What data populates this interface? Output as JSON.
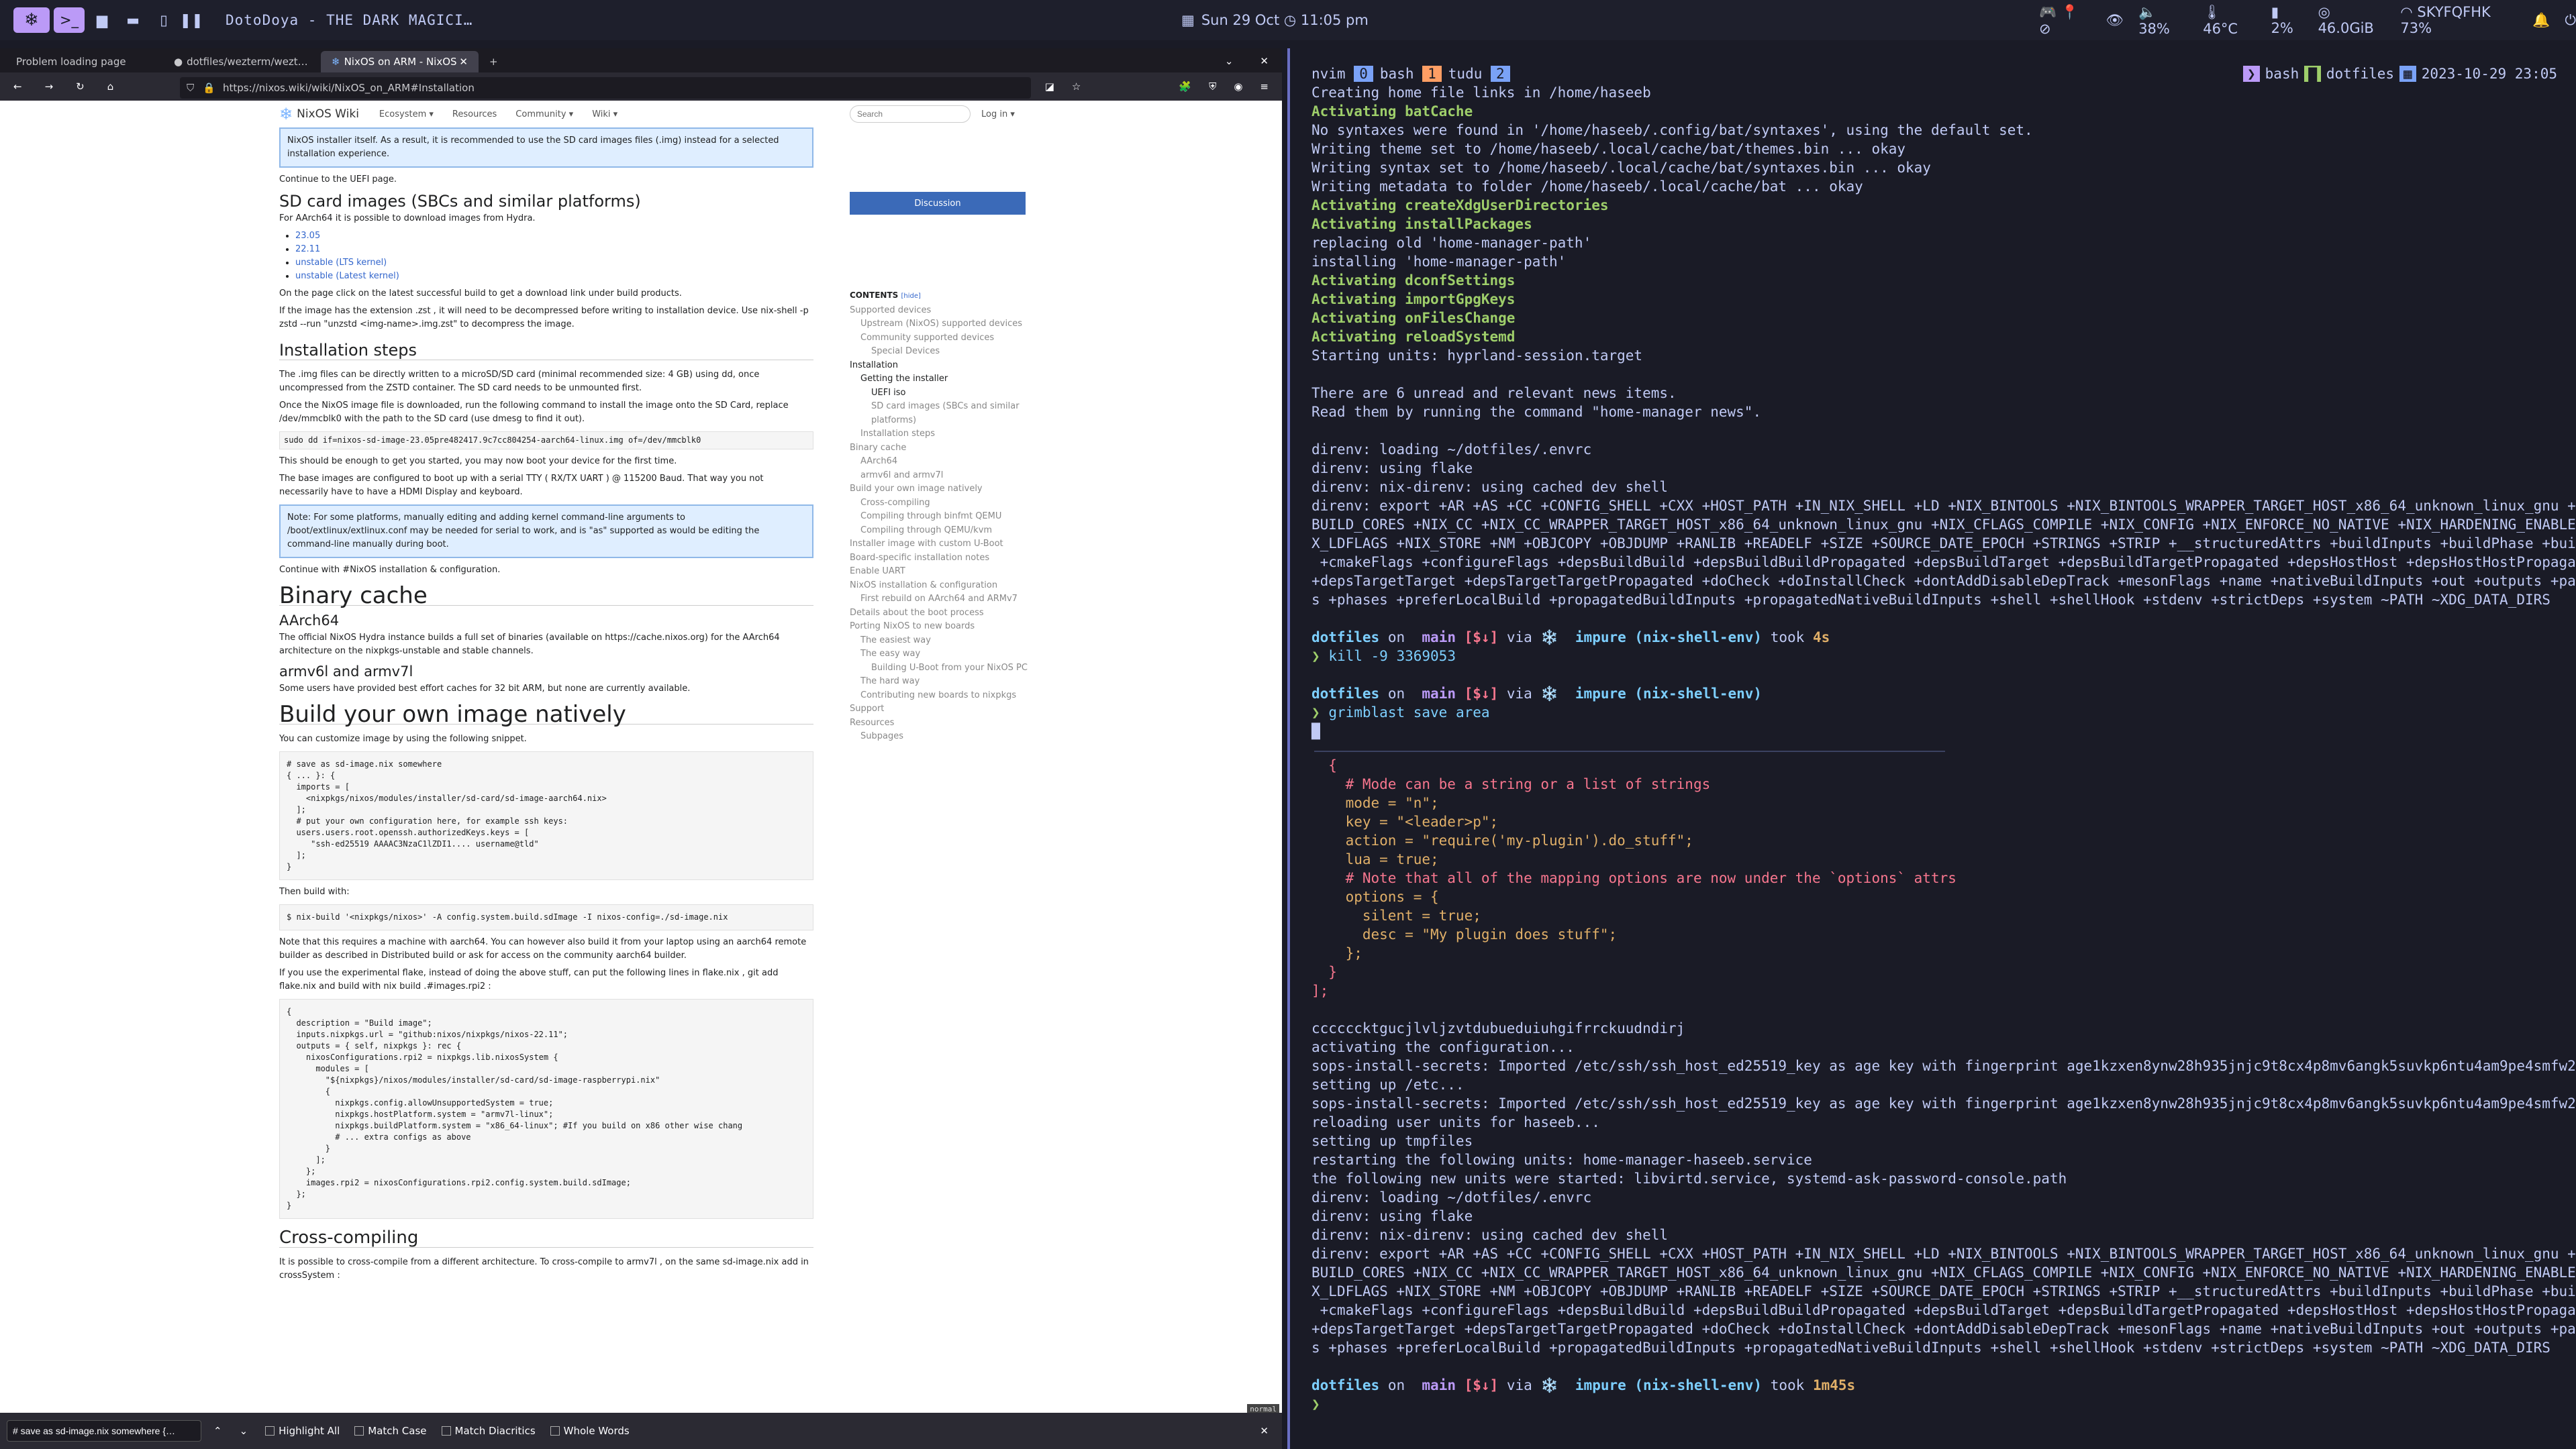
{
  "topbar": {
    "title": "DotoDoya - THE DARK MAGICI…",
    "datetime": "Sun 29 Oct ◷ 11:05 pm",
    "status_icons": "🎮 📍 ⊘",
    "visibility": "👁",
    "volume": "🔈 38%",
    "temp": "🌡 46°C",
    "cpu": "▮ 2%",
    "mem": "◎ 46.0GiB",
    "wifi": "SKYFQFHK 73%",
    "accent": "#bb9af7"
  },
  "browser": {
    "tabs": [
      "Problem loading page",
      "dotfiles/wezterm/wezt…",
      "NixOS on ARM - NixOS"
    ],
    "url": "https://nixos.wiki/wiki/NixOS_on_ARM#Installation",
    "wiki": {
      "site": "NixOS Wiki",
      "menu": [
        "Ecosystem ▾",
        "Resources",
        "Community ▾",
        "Wiki ▾"
      ],
      "search_placeholder": "Search",
      "login": "Log in ▾",
      "discussion": "Discussion",
      "intro_note": "NixOS installer itself. As a result, it is recommended to use the SD card images files (.img) instead for a selected installation experience.",
      "continue_uefi": "Continue to the UEFI page.",
      "sd_title": "SD card images (SBCs and similar platforms)",
      "sd_text": "For AArch64 it is possible to download images from Hydra.",
      "sd_links": [
        "23.05",
        "22.11",
        "unstable (LTS kernel)",
        "unstable (Latest kernel)"
      ],
      "sd_after": "On the page click on the latest successful build to get a download link under build products.",
      "zst_text": "If the image has the extension .zst , it will need to be decompressed before writing to installation device. Use nix-shell -p zstd --run \"unzstd <img-name>.img.zst\" to decompress the image.",
      "install_title": "Installation steps",
      "install_p1": "The .img files can be directly written to a microSD/SD card (minimal recommended size: 4 GB) using dd, once uncompressed from the ZSTD container. The SD card needs to be unmounted first.",
      "install_p2": "Once the NixOS image file is downloaded, run the following command to install the image onto the SD Card, replace /dev/mmcblk0 with the path to the SD card (use dmesg to find it out).",
      "dd_cmd": "sudo dd if=nixos-sd-image-23.05pre482417.9c7cc804254-aarch64-linux.img of=/dev/mmcblk0",
      "install_p3": "This should be enough to get you started, you may now boot your device for the first time.",
      "install_p4": "The base images are configured to boot up with a serial TTY ( RX/TX UART ) @ 115200 Baud. That way you not necessarily have to have a HDMI Display and keyboard.",
      "note2": "Note: For some platforms, manually editing and adding kernel command-line arguments to /boot/extlinux/extlinux.conf may be needed for serial to work, and is \"as\" supported as would be editing the command-line manually during boot.",
      "continue_inst": "Continue with #NixOS installation & configuration.",
      "binary_title": "Binary cache",
      "aarch64_title": "AArch64",
      "aarch64_text": "The official NixOS Hydra instance builds a full set of binaries (available on https://cache.nixos.org) for the AArch64 architecture on the nixpkgs-unstable and stable channels.",
      "armv_title": "armv6l and armv7l",
      "armv_text": "Some users have provided best effort caches for 32 bit ARM, but none are currently available.",
      "build_title": "Build your own image natively",
      "build_p1": "You can customize image by using the following snippet.",
      "code1": "# save as sd-image.nix somewhere\n{ ... }: {\n  imports = [\n    <nixpkgs/nixos/modules/installer/sd-card/sd-image-aarch64.nix>\n  ];\n  # put your own configuration here, for example ssh keys:\n  users.users.root.openssh.authorizedKeys.keys = [\n     \"ssh-ed25519 AAAAC3NzaC1lZDI1.... username@tld\"\n  ];\n}",
      "then_build": "Then build with:",
      "build_cmd": "$ nix-build '<nixpkgs/nixos>' -A config.system.build.sdImage -I nixos-config=./sd-image.nix",
      "build_p2": "Note that this requires a machine with aarch64. You can however also build it from your laptop using an aarch64 remote builder as described in Distributed build or ask for access on the community aarch64 builder.",
      "build_p3": "If you use the experimental flake, instead of doing the above stuff, can put the following lines in flake.nix , git add flake.nix and build with nix build .#images.rpi2 :",
      "code2": "{\n  description = \"Build image\";\n  inputs.nixpkgs.url = \"github:nixos/nixpkgs/nixos-22.11\";\n  outputs = { self, nixpkgs }: rec {\n    nixosConfigurations.rpi2 = nixpkgs.lib.nixosSystem {\n      modules = [\n        \"${nixpkgs}/nixos/modules/installer/sd-card/sd-image-raspberrypi.nix\"\n        {\n          nixpkgs.config.allowUnsupportedSystem = true;\n          nixpkgs.hostPlatform.system = \"armv7l-linux\";\n          nixpkgs.buildPlatform.system = \"x86_64-linux\"; #If you build on x86 other wise chang\n          # ... extra configs as above\n        }\n      ];\n    };\n    images.rpi2 = nixosConfigurations.rpi2.config.system.build.sdImage;\n  };\n}",
      "cross_title": "Cross-compiling",
      "cross_text": "It is possible to cross-compile from a different architecture. To cross-compile to armv7l , on the same sd-image.nix add in crossSystem :",
      "toc_title": "CONTENTS",
      "toc_hide": "[hide]",
      "toc": [
        {
          "t": "Supported devices",
          "l": 1
        },
        {
          "t": "Upstream (NixOS) supported devices",
          "l": 2
        },
        {
          "t": "Community supported devices",
          "l": 2
        },
        {
          "t": "Special Devices",
          "l": 3
        },
        {
          "t": "Installation",
          "l": 1
        },
        {
          "t": "Getting the installer",
          "l": 2
        },
        {
          "t": "UEFI iso",
          "l": 3
        },
        {
          "t": "SD card images (SBCs and similar platforms)",
          "l": 3
        },
        {
          "t": "Installation steps",
          "l": 2
        },
        {
          "t": "Binary cache",
          "l": 1
        },
        {
          "t": "AArch64",
          "l": 2
        },
        {
          "t": "armv6l and armv7l",
          "l": 2
        },
        {
          "t": "Build your own image natively",
          "l": 1
        },
        {
          "t": "Cross-compiling",
          "l": 2
        },
        {
          "t": "Compiling through binfmt QEMU",
          "l": 2
        },
        {
          "t": "Compiling through QEMU/kvm",
          "l": 2
        },
        {
          "t": "Installer image with custom U-Boot",
          "l": 1
        },
        {
          "t": "Board-specific installation notes",
          "l": 1
        },
        {
          "t": "Enable UART",
          "l": 1
        },
        {
          "t": "NixOS installation & configuration",
          "l": 1
        },
        {
          "t": "First rebuild on AArch64 and ARMv7",
          "l": 2
        },
        {
          "t": "Details about the boot process",
          "l": 1
        },
        {
          "t": "Porting NixOS to new boards",
          "l": 1
        },
        {
          "t": "The easiest way",
          "l": 2
        },
        {
          "t": "The easy way",
          "l": 2
        },
        {
          "t": "Building U-Boot from your NixOS PC",
          "l": 3
        },
        {
          "t": "The hard way",
          "l": 2
        },
        {
          "t": "Contributing new boards to nixpkgs",
          "l": 2
        },
        {
          "t": "Support",
          "l": 1
        },
        {
          "t": "Resources",
          "l": 1
        },
        {
          "t": "Subpages",
          "l": 2
        }
      ]
    },
    "findbar": {
      "query": "# save as sd-image.nix somewhere {…",
      "highlight": "Highlight All",
      "match_case": "Match Case",
      "diacritics": "Match Diacritics",
      "whole_words": "Whole Words"
    },
    "mode_badge": "normal"
  },
  "terminal": {
    "tabs": [
      {
        "name": "nvim",
        "n": "0"
      },
      {
        "name": "bash",
        "n": "1"
      },
      {
        "name": "tudu",
        "n": "2"
      }
    ],
    "right_status": [
      "bash",
      "dotfiles",
      "2023-10-29 23:05"
    ],
    "lines": [
      {
        "t": "Creating home file links in /home/haseeb",
        "c": ""
      },
      {
        "t": "Activating batCache",
        "c": "g b"
      },
      {
        "t": "No syntaxes were found in '/home/haseeb/.config/bat/syntaxes', using the default set.",
        "c": ""
      },
      {
        "t": "Writing theme set to /home/haseeb/.local/cache/bat/themes.bin ... okay",
        "c": ""
      },
      {
        "t": "Writing syntax set to /home/haseeb/.local/cache/bat/syntaxes.bin ... okay",
        "c": ""
      },
      {
        "t": "Writing metadata to folder /home/haseeb/.local/cache/bat ... okay",
        "c": ""
      },
      {
        "t": "Activating createXdgUserDirectories",
        "c": "g b"
      },
      {
        "t": "Activating installPackages",
        "c": "g b"
      },
      {
        "t": "replacing old 'home-manager-path'",
        "c": ""
      },
      {
        "t": "installing 'home-manager-path'",
        "c": ""
      },
      {
        "t": "Activating dconfSettings",
        "c": "g b"
      },
      {
        "t": "Activating importGpgKeys",
        "c": "g b"
      },
      {
        "t": "Activating onFilesChange",
        "c": "g b"
      },
      {
        "t": "Activating reloadSystemd",
        "c": "g b"
      },
      {
        "t": "Starting units: hyprland-session.target",
        "c": ""
      },
      {
        "t": "",
        "c": ""
      },
      {
        "t": "There are 6 unread and relevant news items.",
        "c": ""
      },
      {
        "t": "Read them by running the command \"home-manager news\".",
        "c": ""
      },
      {
        "t": "",
        "c": ""
      },
      {
        "t": "direnv: loading ~/dotfiles/.envrc",
        "c": ""
      },
      {
        "t": "direnv: using flake",
        "c": ""
      },
      {
        "t": "direnv: nix-direnv: using cached dev shell",
        "c": ""
      },
      {
        "t": "direnv: export +AR +AS +CC +CONFIG_SHELL +CXX +HOST_PATH +IN_NIX_SHELL +LD +NIX_BINTOOLS +NIX_BINTOOLS_WRAPPER_TARGET_HOST_x86_64_unknown_linux_gnu +NIX_",
        "c": ""
      },
      {
        "t": "BUILD_CORES +NIX_CC +NIX_CC_WRAPPER_TARGET_HOST_x86_64_unknown_linux_gnu +NIX_CFLAGS_COMPILE +NIX_CONFIG +NIX_ENFORCE_NO_NATIVE +NIX_HARDENING_ENABLE +NI",
        "c": ""
      },
      {
        "t": "X_LDFLAGS +NIX_STORE +NM +OBJCOPY +OBJDUMP +RANLIB +READELF +SIZE +SOURCE_DATE_EPOCH +STRINGS +STRIP +__structuredAttrs +buildInputs +buildPhase +builder",
        "c": ""
      },
      {
        "t": " +cmakeFlags +configureFlags +depsBuildBuild +depsBuildBuildPropagated +depsBuildTarget +depsBuildTargetPropagated +depsHostHost +depsHostHostPropagated",
        "c": ""
      },
      {
        "t": "+depsTargetTarget +depsTargetTargetPropagated +doCheck +doInstallCheck +dontAddDisableDepTrack +mesonFlags +name +nativeBuildInputs +out +outputs +patche",
        "c": ""
      },
      {
        "t": "s +phases +preferLocalBuild +propagatedBuildInputs +propagatedNativeBuildInputs +shell +shellHook +stdenv +strictDeps +system ~PATH ~XDG_DATA_DIRS",
        "c": ""
      },
      {
        "t": "",
        "c": ""
      },
      {
        "t": "PROMPT:4s",
        "c": "prompt"
      },
      {
        "t": "❯ kill -9 3369053",
        "c": "cmd"
      },
      {
        "t": "",
        "c": ""
      },
      {
        "t": "PROMPT:",
        "c": "prompt"
      },
      {
        "t": "❯ grimblast save area",
        "c": "cmd"
      },
      {
        "t": "█",
        "c": "cursor"
      }
    ],
    "lines2": [
      {
        "t": "  {",
        "c": "r"
      },
      {
        "t": "    # Mode can be a string or a list of strings",
        "c": "cm"
      },
      {
        "t": "    mode = \"n\";",
        "c": "y"
      },
      {
        "t": "    key = \"<leader>p\";",
        "c": "y"
      },
      {
        "t": "    action = \"require('my-plugin').do_stuff\";",
        "c": "y"
      },
      {
        "t": "    lua = true;",
        "c": "y"
      },
      {
        "t": "    # Note that all of the mapping options are now under the `options` attrs",
        "c": "cm"
      },
      {
        "t": "    options = {",
        "c": "y"
      },
      {
        "t": "      silent = true;",
        "c": "y"
      },
      {
        "t": "      desc = \"My plugin does stuff\";",
        "c": "y"
      },
      {
        "t": "    };",
        "c": "y"
      },
      {
        "t": "  }",
        "c": "r"
      },
      {
        "t": "];",
        "c": "r"
      },
      {
        "t": "",
        "c": ""
      },
      {
        "t": "ccccccktgucjlvljzvtdubueduiuhgifrrckuudndirj",
        "c": ""
      },
      {
        "t": "activating the configuration...",
        "c": ""
      },
      {
        "t": "sops-install-secrets: Imported /etc/ssh/ssh_host_ed25519_key as age key with fingerprint age1kzxen8ynw28h935jnjc9t8cx4p8mv6angk5suvkp6ntu4am9pe4smfw22z",
        "c": ""
      },
      {
        "t": "setting up /etc...",
        "c": ""
      },
      {
        "t": "sops-install-secrets: Imported /etc/ssh/ssh_host_ed25519_key as age key with fingerprint age1kzxen8ynw28h935jnjc9t8cx4p8mv6angk5suvkp6ntu4am9pe4smfw22z",
        "c": ""
      },
      {
        "t": "reloading user units for haseeb...",
        "c": ""
      },
      {
        "t": "setting up tmpfiles",
        "c": ""
      },
      {
        "t": "restarting the following units: home-manager-haseeb.service",
        "c": ""
      },
      {
        "t": "the following new units were started: libvirtd.service, systemd-ask-password-console.path",
        "c": ""
      },
      {
        "t": "direnv: loading ~/dotfiles/.envrc",
        "c": ""
      },
      {
        "t": "direnv: using flake",
        "c": ""
      },
      {
        "t": "direnv: nix-direnv: using cached dev shell",
        "c": ""
      },
      {
        "t": "direnv: export +AR +AS +CC +CONFIG_SHELL +CXX +HOST_PATH +IN_NIX_SHELL +LD +NIX_BINTOOLS +NIX_BINTOOLS_WRAPPER_TARGET_HOST_x86_64_unknown_linux_gnu +NIX_",
        "c": ""
      },
      {
        "t": "BUILD_CORES +NIX_CC +NIX_CC_WRAPPER_TARGET_HOST_x86_64_unknown_linux_gnu +NIX_CFLAGS_COMPILE +NIX_CONFIG +NIX_ENFORCE_NO_NATIVE +NIX_HARDENING_ENABLE +NI",
        "c": ""
      },
      {
        "t": "X_LDFLAGS +NIX_STORE +NM +OBJCOPY +OBJDUMP +RANLIB +READELF +SIZE +SOURCE_DATE_EPOCH +STRINGS +STRIP +__structuredAttrs +buildInputs +buildPhase +builder",
        "c": ""
      },
      {
        "t": " +cmakeFlags +configureFlags +depsBuildBuild +depsBuildBuildPropagated +depsBuildTarget +depsBuildTargetPropagated +depsHostHost +depsHostHostPropagated",
        "c": ""
      },
      {
        "t": "+depsTargetTarget +depsTargetTargetPropagated +doCheck +doInstallCheck +dontAddDisableDepTrack +mesonFlags +name +nativeBuildInputs +out +outputs +patche",
        "c": ""
      },
      {
        "t": "s +phases +preferLocalBuild +propagatedBuildInputs +propagatedNativeBuildInputs +shell +shellHook +stdenv +strictDeps +system ~PATH ~XDG_DATA_DIRS",
        "c": ""
      },
      {
        "t": "",
        "c": ""
      },
      {
        "t": "PROMPT:1m45s",
        "c": "prompt"
      },
      {
        "t": "❯ ",
        "c": "cmd"
      }
    ],
    "prompt": {
      "dir": "dotfiles",
      "on": "on",
      "branch": " main",
      "status": "[$↓]",
      "via": "via",
      "env": "❄️  impure (nix-shell-env)",
      "took": "took"
    }
  }
}
